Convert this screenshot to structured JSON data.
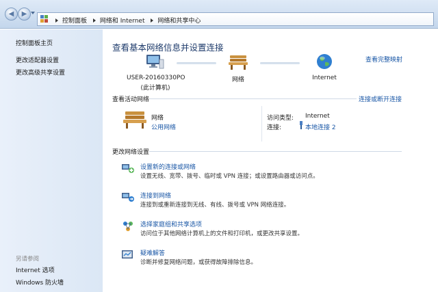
{
  "address_bar": {
    "crumbs": [
      "控制面板",
      "网络和 Internet",
      "网络和共享中心"
    ]
  },
  "left_pane": {
    "items": [
      "控制面板主页",
      "更改适配器设置",
      "更改高级共享设置"
    ],
    "see_also_heading": "另请参阅",
    "see_also": [
      "Internet 选项",
      "Windows 防火墙"
    ]
  },
  "main": {
    "title": "查看基本网络信息并设置连接",
    "full_map_link": "查看完整映射",
    "map": {
      "computer_name": "USER-20160330PO",
      "computer_sub": "(此计算机)",
      "network_label": "网络",
      "internet_label": "Internet"
    },
    "active": {
      "heading": "查看活动网络",
      "connect_link": "连接或断开连接",
      "network_name": "网络",
      "network_type": "公用网络",
      "access_type_label": "访问类型:",
      "access_type_value": "Internet",
      "connection_label": "连接:",
      "connection_value": "本地连接 2"
    },
    "change_heading": "更改网络设置",
    "tasks": [
      {
        "link": "设置新的连接或网络",
        "desc": "设置无线、宽带、拨号、临时或 VPN 连接；或设置路由器或访问点。"
      },
      {
        "link": "连接到网络",
        "desc": "连接到或重新连接到无线、有线、拨号或 VPN 网络连接。"
      },
      {
        "link": "选择家庭组和共享选项",
        "desc": "访问位于其他网络计算机上的文件和打印机，或更改共享设置。"
      },
      {
        "link": "疑难解答",
        "desc": "诊断并修复网络问题，或获得故障排除信息。"
      }
    ]
  },
  "colors": {
    "link": "#1a57a6",
    "title": "#1e3b6b",
    "left_pane_bg": "#dbe7f5"
  }
}
